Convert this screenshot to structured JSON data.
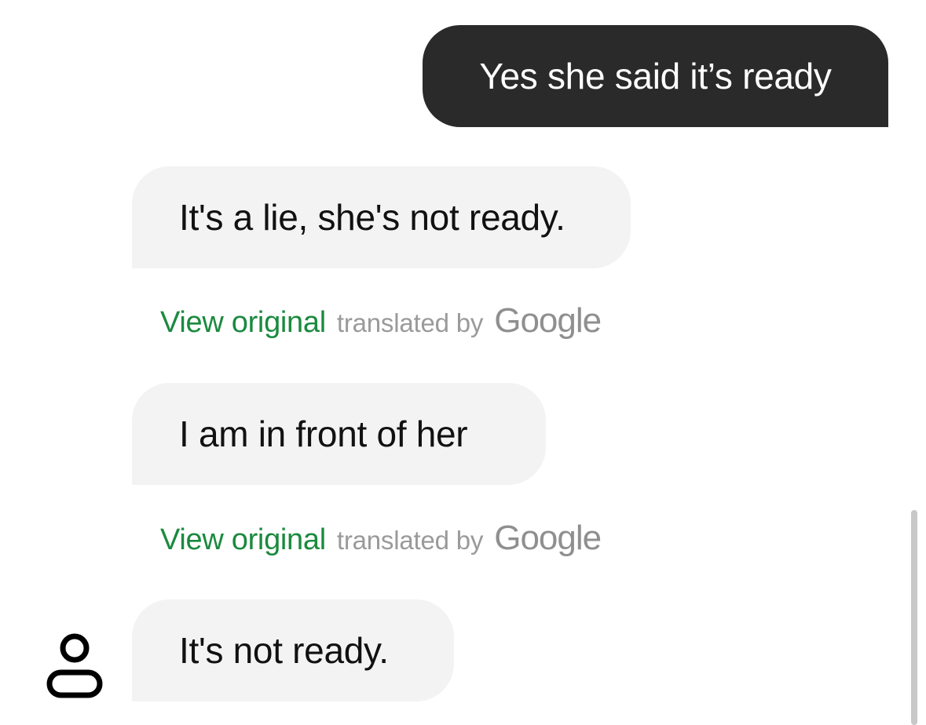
{
  "messages": [
    {
      "direction": "outgoing",
      "text": "Yes she said it’s ready"
    },
    {
      "direction": "incoming",
      "text": "It's a lie, she's not ready.",
      "view_original_label": "View original",
      "translated_by_label": "translated by",
      "translator_name": "Google"
    },
    {
      "direction": "incoming",
      "text": "I am in front of her",
      "view_original_label": "View original",
      "translated_by_label": "translated by",
      "translator_name": "Google"
    },
    {
      "direction": "incoming",
      "text": "It's not ready."
    }
  ],
  "icons": {
    "sender_avatar": "person-icon"
  },
  "colors": {
    "outgoing_bubble": "#2a2a2a",
    "incoming_bubble": "#f3f3f3",
    "view_original_link": "#1a8a3e",
    "translated_by_text": "#9a9a9a"
  }
}
